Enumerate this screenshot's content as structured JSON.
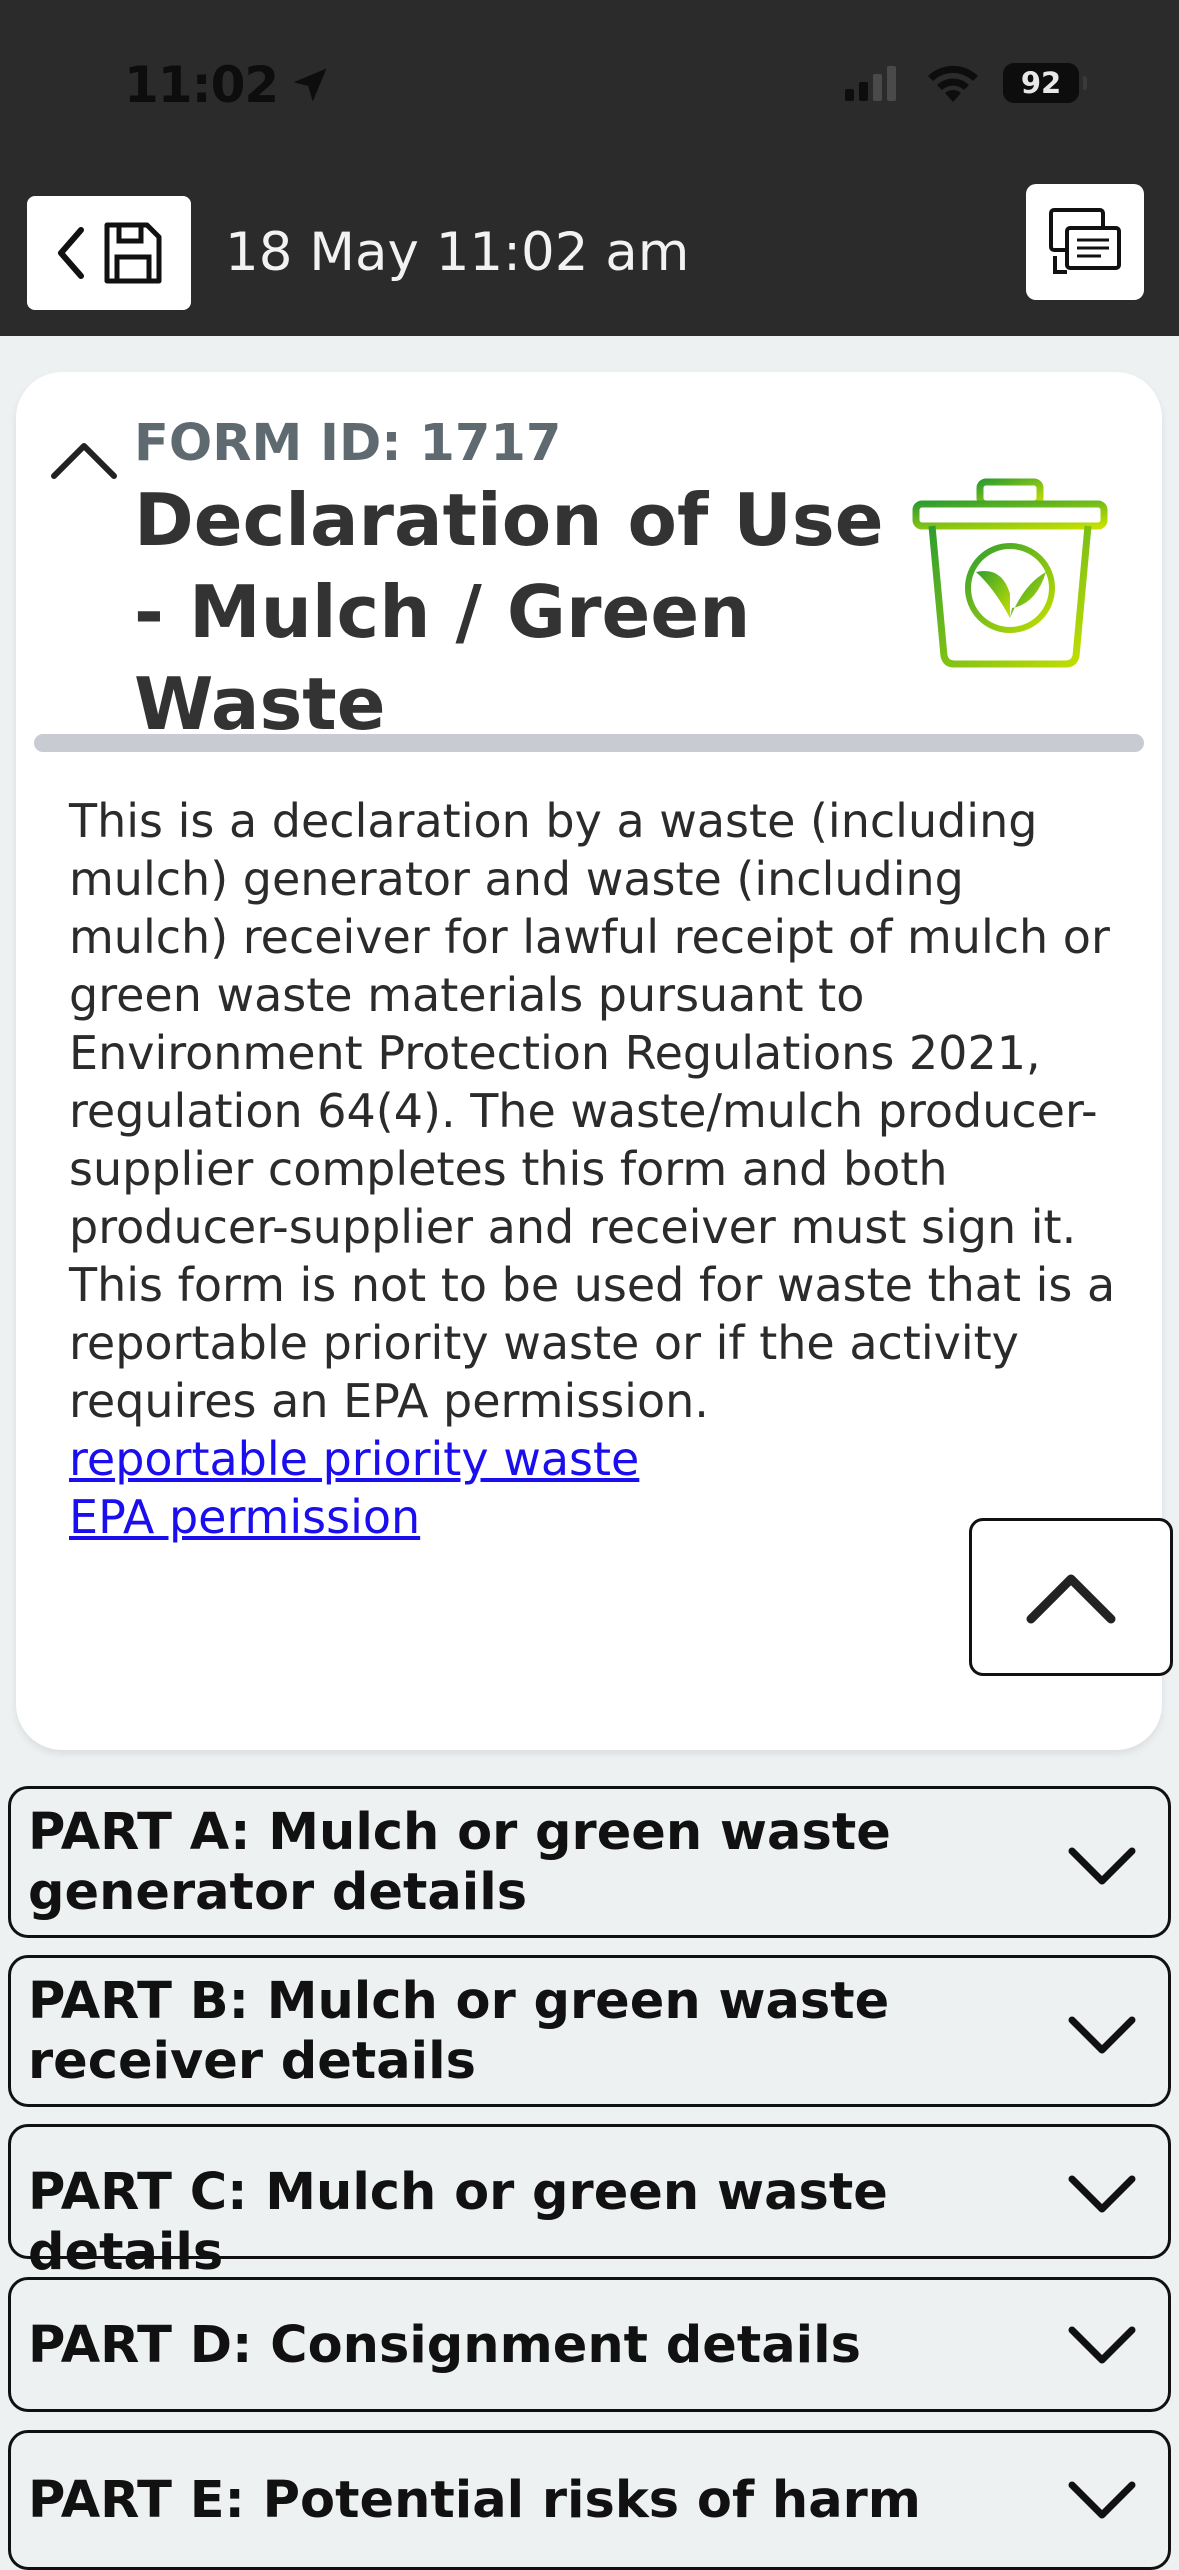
{
  "status_bar": {
    "time": "11:02",
    "battery": "92",
    "icons": [
      "location-arrow-icon",
      "cellular-signal-icon",
      "wifi-icon",
      "battery-icon"
    ]
  },
  "header": {
    "datetime": "18 May 11:02 am",
    "icons": [
      "chevron-left-icon",
      "floppy-disk-icon",
      "share-screen-icon"
    ]
  },
  "form": {
    "form_id_label": "FORM ID: 1717",
    "title": "Declaration of Use - Mulch / Green Waste",
    "icon": "green-waste-bin-icon",
    "description": "This is a declaration by a waste (including mulch) generator and waste (including mulch) receiver for lawful receipt of mulch or green waste materials pursuant to Environment Protection Regulations 2021, regulation 64(4). The waste/mulch producer-supplier completes this form and both producer-supplier and receiver must sign it. This form is not to be used for waste that is a reportable priority waste or if the activity requires an EPA permission.",
    "links": [
      "reportable priority waste",
      "EPA permission"
    ]
  },
  "sections": [
    {
      "label": "PART A: Mulch or green waste generator details"
    },
    {
      "label": "PART B: Mulch or green waste receiver details"
    },
    {
      "label": "PART C:  Mulch or green waste details"
    },
    {
      "label": "PART D: Consignment details"
    },
    {
      "label": "PART E: Potential risks of harm"
    }
  ],
  "colors": {
    "header_bg": "#2b2b2b",
    "page_bg": "#edf1f2",
    "link": "#1a0dee",
    "icon_green_start": "#2f9e2f",
    "icon_green_end": "#c6e000"
  }
}
